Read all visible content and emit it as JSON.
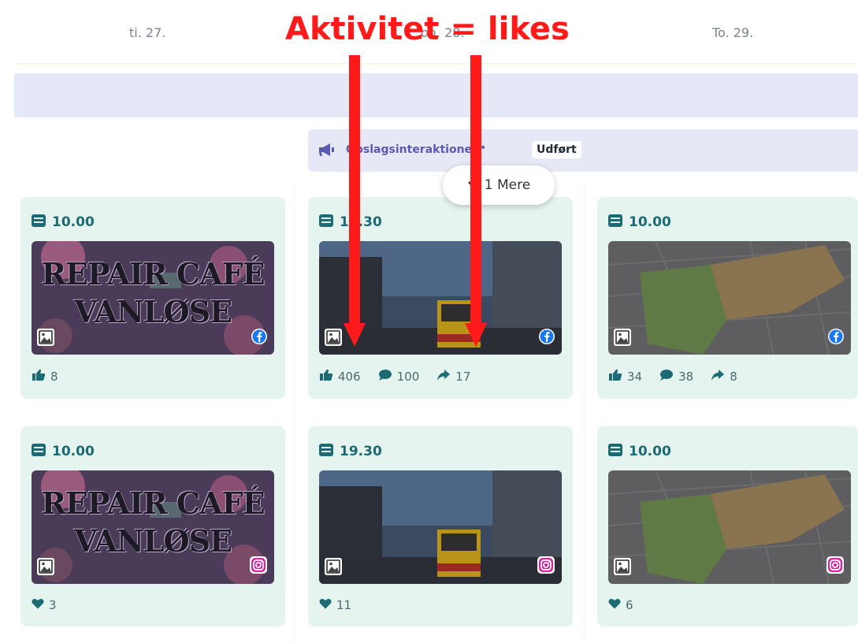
{
  "days": [
    "ti. 27.",
    "on. 28.",
    "To. 29."
  ],
  "annotation": {
    "text": "Aktivitet = likes",
    "color": "#ff1a1a"
  },
  "event": {
    "label": "Opslagsinteraktioner",
    "separator": "•",
    "status": "Udført",
    "icon": "megaphone-icon"
  },
  "more": {
    "label": "1 Mere",
    "icon": "chevron-down-icon"
  },
  "colors": {
    "card_bg": "#e5f4ee",
    "time": "#1c6a73",
    "event_bg": "#e6e8f6",
    "accent_purple": "#5a5bb0"
  },
  "cards": [
    {
      "time": "10.00",
      "network": "facebook",
      "image": "Repair Café Vanløse poster",
      "poster_text": [
        "REPAIR CAFÉ",
        "VANLØSE"
      ],
      "stats": [
        {
          "icon": "thumbs-up-icon",
          "value": "8"
        }
      ]
    },
    {
      "time": "19.30",
      "network": "facebook",
      "image": "street with yellow bus",
      "stats": [
        {
          "icon": "thumbs-up-icon",
          "value": "406"
        },
        {
          "icon": "comment-icon",
          "value": "100"
        },
        {
          "icon": "share-icon",
          "value": "17"
        }
      ]
    },
    {
      "time": "10.00",
      "network": "facebook",
      "image": "map with highlighted areas",
      "stats": [
        {
          "icon": "thumbs-up-icon",
          "value": "34"
        },
        {
          "icon": "comment-icon",
          "value": "38"
        },
        {
          "icon": "share-icon",
          "value": "8"
        }
      ]
    },
    {
      "time": "10.00",
      "network": "instagram",
      "image": "Repair Café Vanløse poster",
      "poster_text": [
        "REPAIR CAFÉ",
        "VANLØSE"
      ],
      "stats": [
        {
          "icon": "heart-icon",
          "value": "3"
        }
      ]
    },
    {
      "time": "19.30",
      "network": "instagram",
      "image": "street with yellow bus",
      "stats": [
        {
          "icon": "heart-icon",
          "value": "11"
        }
      ]
    },
    {
      "time": "10.00",
      "network": "instagram",
      "image": "map with highlighted areas",
      "stats": [
        {
          "icon": "heart-icon",
          "value": "6"
        }
      ]
    }
  ]
}
